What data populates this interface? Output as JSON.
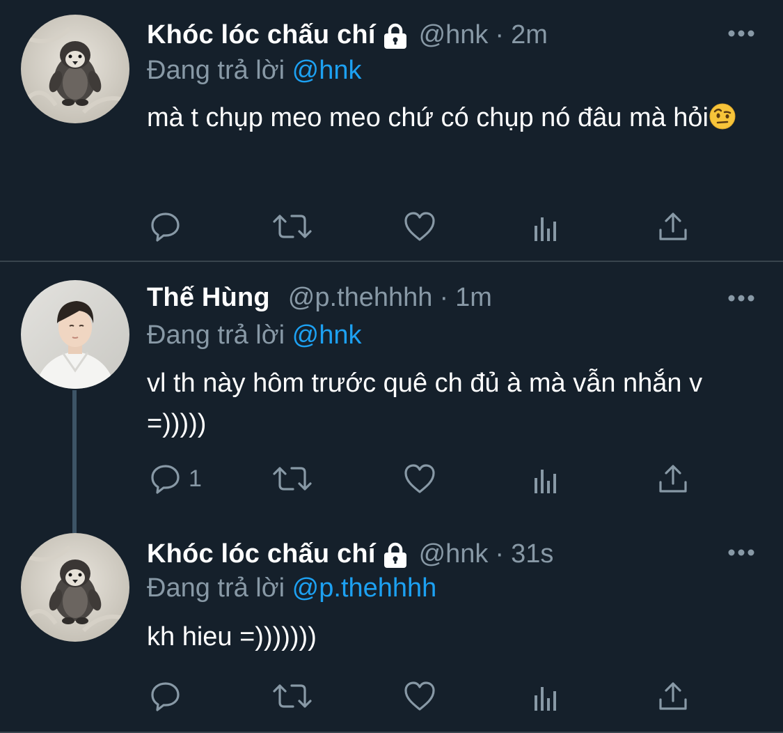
{
  "tweets": [
    {
      "name": "Khóc lóc chấu chí",
      "protected": true,
      "handle": "@hnk",
      "dot": "·",
      "time": "2m",
      "reply_prefix": "Đang trả lời",
      "reply_mention": "@hnk",
      "text": "mà t chụp meo meo chứ có chụp nó đâu mà hỏi",
      "emoji": "face-with-raised-eyebrow",
      "reply_count": ""
    },
    {
      "name": "Thế Hùng",
      "protected": false,
      "handle": "@p.thehhhh",
      "dot": "·",
      "time": "1m",
      "reply_prefix": "Đang trả lời",
      "reply_mention": "@hnk",
      "text": "vl th này hôm trước quê ch đủ à mà vẫn nhắn v =)))))",
      "reply_count": "1"
    },
    {
      "name": "Khóc lóc chấu chí",
      "protected": true,
      "handle": "@hnk",
      "dot": "·",
      "time": "31s",
      "reply_prefix": "Đang trả lời",
      "reply_mention": "@p.thehhhh",
      "text": "kh hieu =)))))))",
      "reply_count": ""
    }
  ],
  "icons": {
    "reply": "reply-icon",
    "retweet": "retweet-icon",
    "like": "like-icon",
    "analytics": "analytics-icon",
    "share": "share-icon",
    "more": "more-icon",
    "lock": "lock-icon"
  },
  "colors": {
    "background": "#15202b",
    "secondary_text": "#8899a6",
    "link": "#1da1f2",
    "divider": "#38444d",
    "thread_line": "#3d5466"
  }
}
